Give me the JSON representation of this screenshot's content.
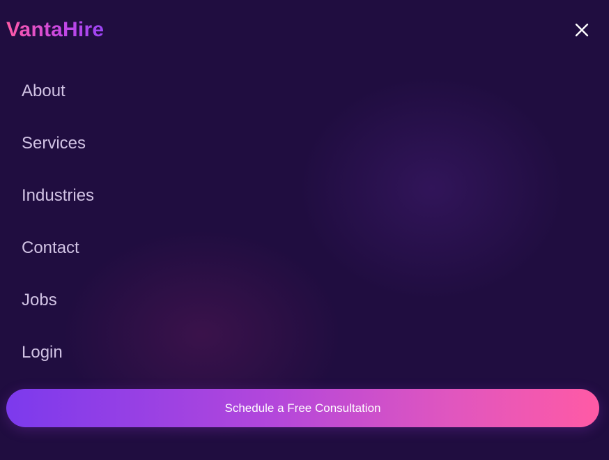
{
  "brand": {
    "logo_text": "VantaHire"
  },
  "header": {
    "close_icon": "close-icon"
  },
  "nav": {
    "items": [
      {
        "label": "About"
      },
      {
        "label": "Services"
      },
      {
        "label": "Industries"
      },
      {
        "label": "Contact"
      },
      {
        "label": "Jobs"
      },
      {
        "label": "Login"
      }
    ]
  },
  "cta": {
    "label": "Schedule a Free Consultation"
  },
  "colors": {
    "background": "#200d40",
    "nav_text": "#d1c3e4",
    "gradient_start": "#7c3aed",
    "gradient_end": "#ff5aa5"
  }
}
